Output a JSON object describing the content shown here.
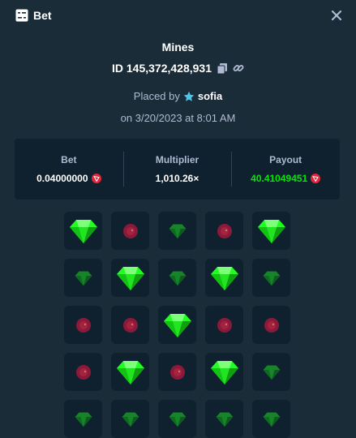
{
  "header": {
    "title": "Bet",
    "icon": "bet-slip-icon",
    "close_icon": "close-icon"
  },
  "game": {
    "name": "Mines",
    "id_text": "ID 145,372,428,931",
    "placed_by_label": "Placed by",
    "username": "sofia",
    "date_text": "on 3/20/2023 at 8:01 AM"
  },
  "stats": {
    "bet_label": "Bet",
    "bet_value": "0.04000000",
    "multiplier_label": "Multiplier",
    "multiplier_value": "1,010.26×",
    "payout_label": "Payout",
    "payout_value": "40.41049451",
    "currency_icon": "tron-coin-icon"
  },
  "board": {
    "tiles": [
      "gem-revealed",
      "mine-dim",
      "gem-dim",
      "mine-dim",
      "gem-revealed",
      "gem-dim",
      "gem-revealed",
      "gem-dim",
      "gem-revealed",
      "gem-dim",
      "mine-dim",
      "mine-dim",
      "gem-revealed",
      "mine-dim",
      "mine-dim",
      "mine-dim",
      "gem-revealed",
      "mine-dim",
      "gem-revealed",
      "gem-dim",
      "gem-dim",
      "gem-dim",
      "gem-dim",
      "gem-dim",
      "gem-dim"
    ]
  },
  "colors": {
    "background": "#1a2c38",
    "panel": "#0f212e",
    "muted_text": "#b1bad3",
    "payout_green": "#00e701",
    "gem_green": "#1fff20",
    "mine_red": "#8b1a3a"
  }
}
